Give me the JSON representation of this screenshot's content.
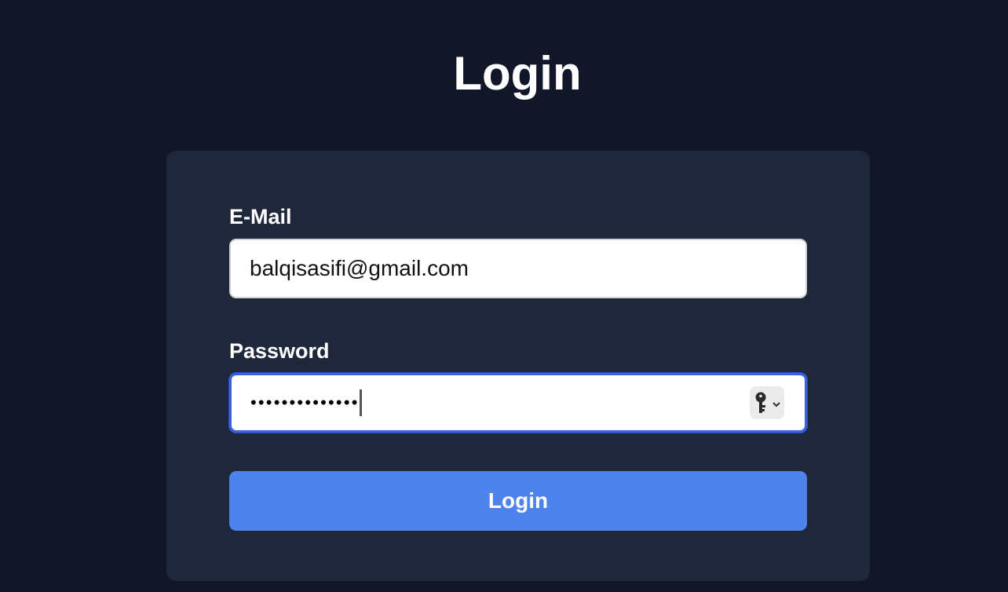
{
  "page": {
    "title": "Login"
  },
  "form": {
    "email": {
      "label": "E-Mail",
      "value": "balqisasifi@gmail.com"
    },
    "password": {
      "label": "Password",
      "masked_value": "••••••••••••••"
    },
    "submit_label": "Login"
  },
  "icons": {
    "password_manager": "key-icon",
    "dropdown": "chevron-down-icon"
  },
  "colors": {
    "background": "#111729",
    "card": "#1f283b",
    "accent": "#4f83ec",
    "focus_border": "#3b63e0"
  }
}
